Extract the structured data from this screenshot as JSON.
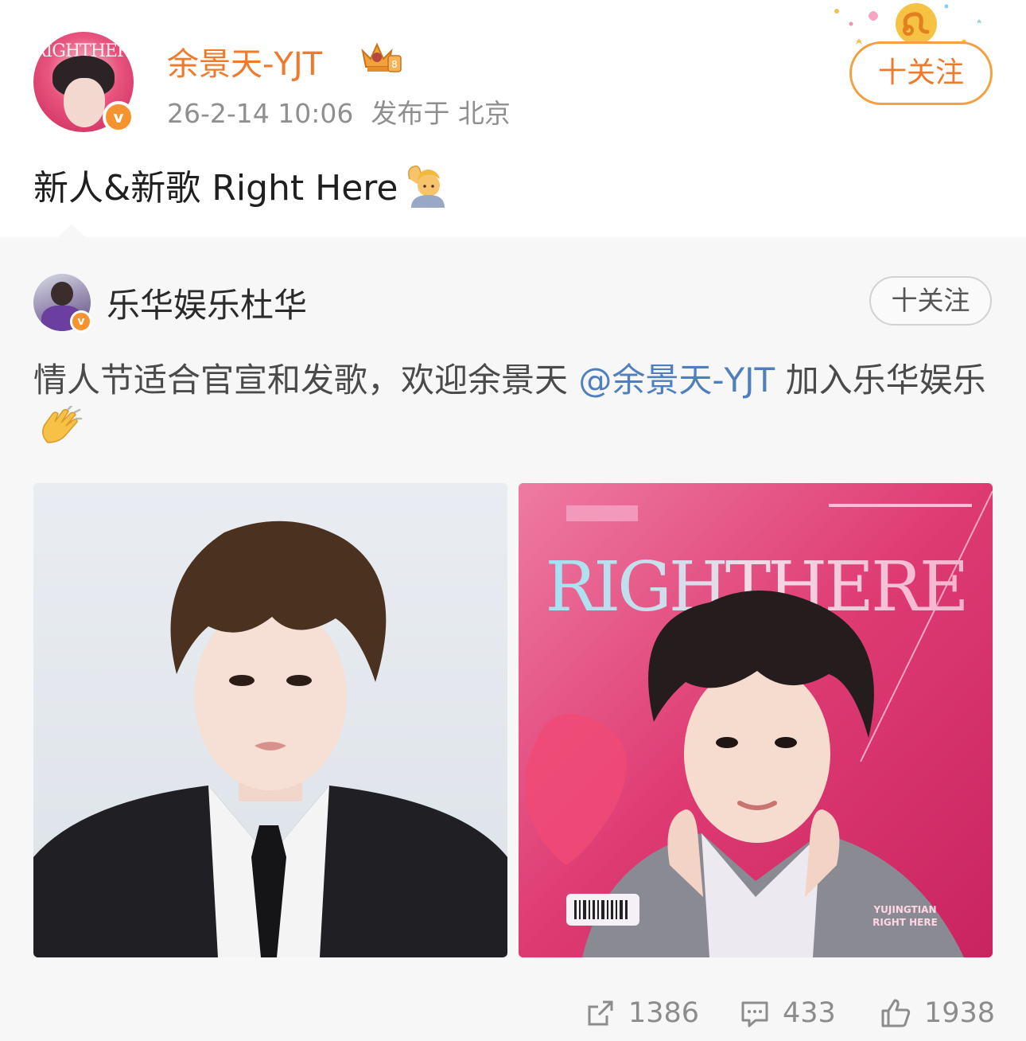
{
  "post": {
    "username": "余景天-YJT",
    "timestamp": "26-2-14 10:06",
    "location": "发布于 北京",
    "follow_label": "十关注",
    "text": "新人&新歌 Right Here",
    "avatar_caption": "RIGHTHERE"
  },
  "repost": {
    "username": "乐华娱乐杜华",
    "follow_label": "十关注",
    "text_before": "情人节适合官宣和发歌，欢迎余景天 ",
    "mention": "@余景天-YJT",
    "text_after": " 加入乐华娱乐",
    "images": [
      {
        "name": "portrait-suit"
      },
      {
        "name": "album-cover-right-here",
        "title": "RIGHTHERE",
        "caption_line1": "YUJINGTIAN",
        "caption_line2": "RIGHT HERE"
      }
    ]
  },
  "stats": {
    "shares": "1386",
    "comments": "433",
    "likes": "1938"
  },
  "colors": {
    "accent_orange": "#f07a2b",
    "mention_blue": "#4f7fbd",
    "verified_orange": "#f7932e",
    "repost_background": "#f7f7f7"
  },
  "icons": [
    "verified-badge-icon",
    "crown-level-icon",
    "leo-zodiac-icon",
    "share-icon",
    "comment-icon",
    "like-icon"
  ]
}
